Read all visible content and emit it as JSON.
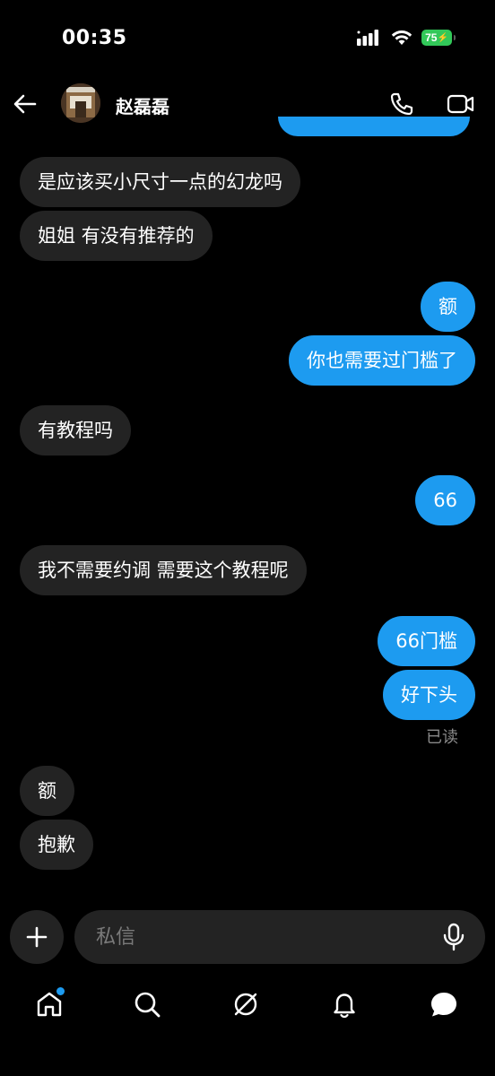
{
  "status_bar": {
    "time": "00:35",
    "battery": "75"
  },
  "header": {
    "contact_name": "赵磊磊",
    "avatar_icon": "profile-photo",
    "back_icon": "arrow-left-icon",
    "call_icon": "phone-icon",
    "video_icon": "video-camera-icon"
  },
  "messages": [
    {
      "side": "in",
      "text": "是应该买小尺寸一点的幻龙吗"
    },
    {
      "side": "in",
      "text": "姐姐 有没有推荐的"
    },
    {
      "side": "out",
      "text": "额"
    },
    {
      "side": "out",
      "text": "你也需要过门槛了"
    },
    {
      "side": "in",
      "text": "有教程吗"
    },
    {
      "side": "out",
      "text": "66"
    },
    {
      "side": "in",
      "text": "我不需要约调 需要这个教程呢"
    },
    {
      "side": "out",
      "text": "66门槛"
    },
    {
      "side": "out",
      "text": "好下头"
    },
    {
      "side": "in",
      "text": "额"
    },
    {
      "side": "in",
      "text": "抱歉"
    }
  ],
  "read_receipt": "已读",
  "composer": {
    "placeholder": "私信",
    "plus_icon": "plus-icon",
    "mic_icon": "microphone-icon"
  },
  "bottom_nav": [
    {
      "name": "home",
      "icon": "home-icon",
      "badge": true
    },
    {
      "name": "search",
      "icon": "search-icon",
      "badge": false
    },
    {
      "name": "grok",
      "icon": "grok-icon",
      "badge": false
    },
    {
      "name": "notifications",
      "icon": "bell-icon",
      "badge": false
    },
    {
      "name": "messages",
      "icon": "messages-icon",
      "badge": false
    }
  ],
  "colors": {
    "background": "#000000",
    "incoming_bubble": "#232323",
    "outgoing_bubble": "#1d9bf0",
    "battery": "#32c859",
    "muted_text": "#8a8a8a"
  }
}
